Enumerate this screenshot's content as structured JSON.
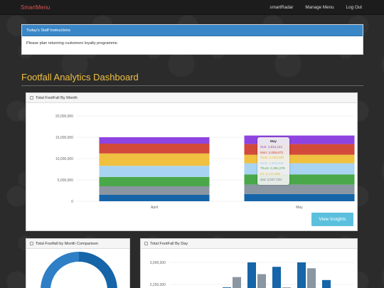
{
  "nav": {
    "brand": "SmartMenu",
    "links": [
      "smartRadar",
      "Manage Menu",
      "Log Out"
    ]
  },
  "staff_instructions": {
    "heading": "Today's Staff Instructions",
    "message": "Please plan returning customers loyalty programme."
  },
  "page_title": "Footfall Analytics Dashboard",
  "panels": {
    "monthly": "Total FootFall By Month",
    "comparison": "Total Footfall by Month Comparison",
    "by_day": "Total FootFall By Day"
  },
  "view_insights_label": "View Insights",
  "tooltip": {
    "title": "May",
    "rows": [
      {
        "text": "Sun: 1,812,141",
        "color": "#7a4ad6"
      },
      {
        "text": "Mon: 2,009,873",
        "color": "#c94a3a"
      },
      {
        "text": "Tues: 2,433,439",
        "color": "#e8b830"
      },
      {
        "text": "Wed: 2,519,069",
        "color": "#9ecff0"
      },
      {
        "text": "Thurs: 2,391,076",
        "color": "#4aa84a"
      },
      {
        "text": "Fri: 2,747,992",
        "color": "#e8b830"
      },
      {
        "text": "Sat: 2,027,734",
        "color": "#6a7a8a"
      }
    ]
  },
  "chart_data": [
    {
      "type": "bar",
      "stacked": true,
      "title": "Total FootFall By Month",
      "categories": [
        "April",
        "May"
      ],
      "ylim": [
        0,
        20000000
      ],
      "yticks": [
        "0",
        "5,000,000",
        "10,000,000",
        "15,000,000",
        "20,000,000"
      ],
      "series": [
        {
          "color": "#1565a8",
          "values": [
            1500000,
            1700000
          ]
        },
        {
          "color": "#8a96a2",
          "values": [
            2000000,
            2200000
          ]
        },
        {
          "color": "#4aa84a",
          "values": [
            2200000,
            2400000
          ]
        },
        {
          "color": "#a8d4f2",
          "values": [
            2600000,
            2600000
          ]
        },
        {
          "color": "#f0c040",
          "values": [
            2900000,
            2000000
          ]
        },
        {
          "color": "#d24a3a",
          "values": [
            2300000,
            2500000
          ]
        },
        {
          "color": "#8e44e0",
          "values": [
            1500000,
            2000000
          ]
        }
      ]
    },
    {
      "type": "bar",
      "title": "Total FootFall By Day",
      "yticks": [
        "3,000,000",
        "2,250,000"
      ],
      "series": [
        {
          "color": "#1565a8",
          "values": [
            2150000,
            3000000,
            2850000,
            3000000,
            2400000
          ]
        },
        {
          "color": "#8a96a2",
          "values": [
            2500000,
            2600000,
            2150000,
            2800000
          ]
        }
      ]
    }
  ]
}
